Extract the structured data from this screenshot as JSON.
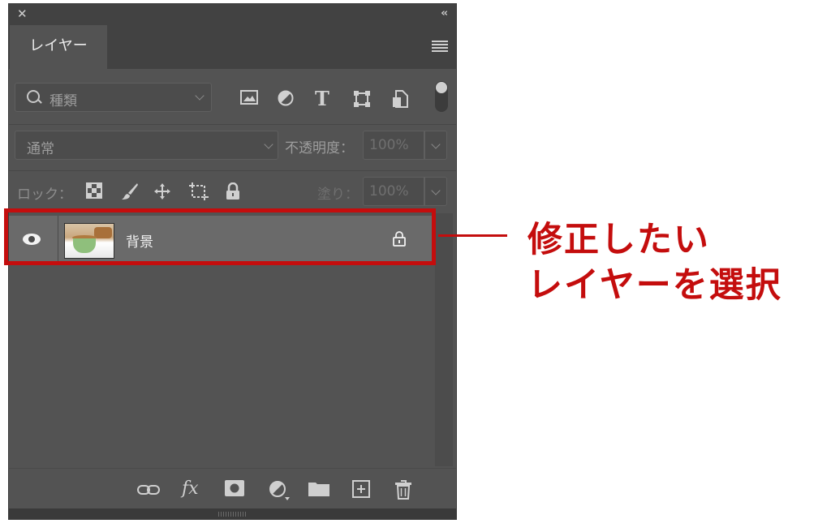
{
  "panel": {
    "close_glyph": "✕",
    "collapse_glyph": "‹‹",
    "tab_label": "レイヤー"
  },
  "filter": {
    "placeholder": "種類",
    "icons": [
      "image-filter-icon",
      "adjustment-filter-icon",
      "type-filter-icon",
      "shape-filter-icon",
      "smart-object-filter-icon"
    ],
    "type_glyph": "T"
  },
  "blend": {
    "mode": "通常",
    "opacity_label": "不透明度：",
    "opacity_value": "100%"
  },
  "lock": {
    "label": "ロック：",
    "fill_label": "塗り：",
    "fill_value": "100%"
  },
  "layers": [
    {
      "name": "背景",
      "visible": true,
      "locked": true,
      "selected": true
    }
  ],
  "annotation": {
    "line1": "修正したい",
    "line2": "レイヤーを選択",
    "color": "#c40d0d"
  },
  "bottom": {
    "fx_label": "fx",
    "icons": [
      "link-layers-icon",
      "fx-icon",
      "add-mask-icon",
      "adjustment-layer-icon",
      "new-group-icon",
      "new-layer-icon",
      "delete-layer-icon"
    ]
  }
}
